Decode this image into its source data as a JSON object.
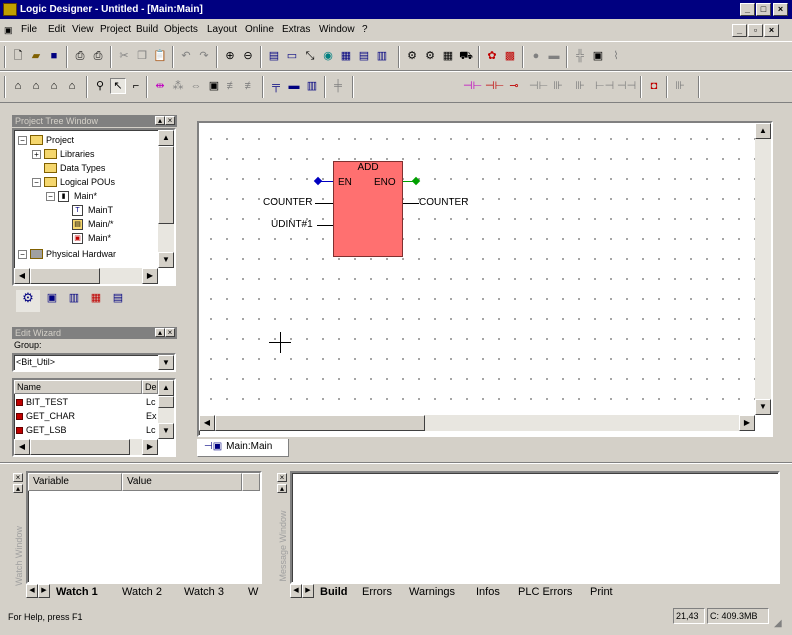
{
  "window": {
    "title": "Logic Designer - Untitled - [Main:Main]"
  },
  "menu": [
    "File",
    "Edit",
    "View",
    "Project",
    "Build",
    "Objects",
    "Layout",
    "Online",
    "Extras",
    "Window",
    "?"
  ],
  "project_tree": {
    "title": "Project Tree Window",
    "items": [
      "Project",
      "Libraries",
      "Data Types",
      "Logical POUs",
      "Main*",
      "MainT",
      "Main/*",
      "Main*",
      "Physical Hardwar"
    ]
  },
  "edit_wizard": {
    "title": "Edit Wizard",
    "group_label": "Group:",
    "group_value": "<Bit_Util>",
    "col_name": "Name",
    "col_desc": "De",
    "rows": [
      {
        "name": "BIT_TEST",
        "desc": "Lc"
      },
      {
        "name": "GET_CHAR",
        "desc": "Ex"
      },
      {
        "name": "GET_LSB",
        "desc": "Lc"
      }
    ]
  },
  "fbd": {
    "block_name": "ADD",
    "en": "EN",
    "eno": "ENO",
    "in1": "COUNTER",
    "in2": "UDINT#1",
    "out": "COUNTER"
  },
  "editor_tab": "Main:Main",
  "watch": {
    "side_label": "Watch Window",
    "col_variable": "Variable",
    "col_value": "Value",
    "tabs": [
      "Watch 1",
      "Watch 2",
      "Watch 3",
      "W"
    ]
  },
  "message": {
    "side_label": "Message Window",
    "tabs": [
      "Build",
      "Errors",
      "Warnings",
      "Infos",
      "PLC Errors",
      "Print"
    ]
  },
  "status": {
    "help": "For Help, press F1",
    "position": "21,43",
    "memory": "C: 409.3MB"
  }
}
